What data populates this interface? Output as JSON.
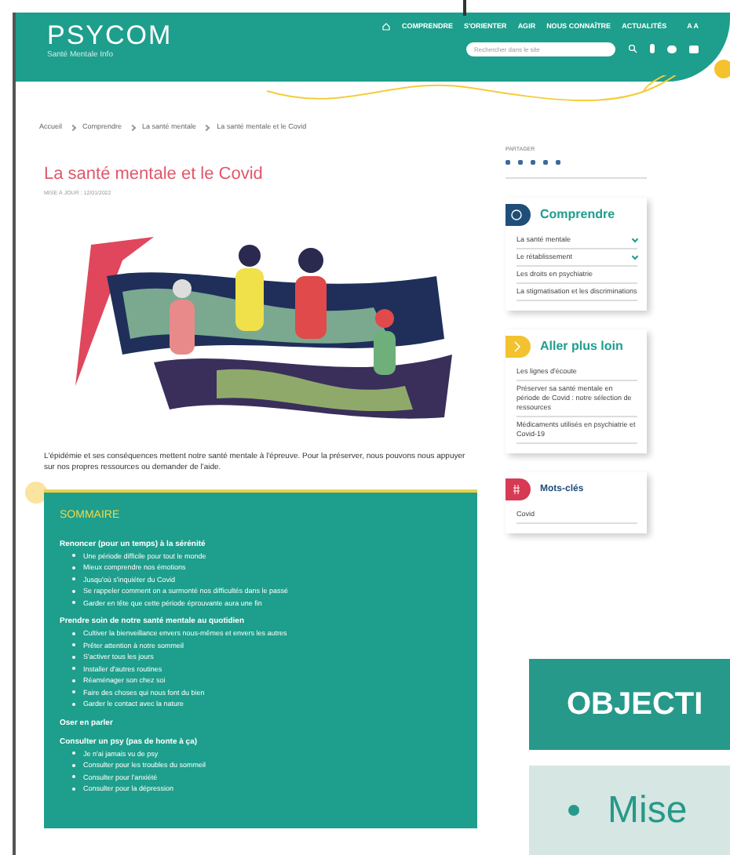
{
  "header": {
    "logo": "PSYCOM",
    "tagline": "Santé Mentale Info",
    "nav": [
      "COMPRENDRE",
      "S'ORIENTER",
      "AGIR",
      "NOUS CONNAÎTRE",
      "ACTUALITÉS"
    ],
    "font_size": "A A",
    "search": {
      "placeholder": "Rechercher dans le site"
    }
  },
  "breadcrumb": [
    "Accueil",
    "Comprendre",
    "La santé mentale",
    "La santé mentale et le Covid"
  ],
  "article": {
    "title": "La santé mentale et le Covid",
    "date": "MISE À JOUR : 12/01/2022",
    "intro": "L'épidémie et ses conséquences mettent notre santé mentale à l'épreuve. Pour la préserver, nous pouvons nous appuyer sur nos propres ressources ou demander de l'aide."
  },
  "summary": {
    "title": "SOMMAIRE",
    "sections": [
      {
        "heading": "Renoncer (pour un temps) à la sérénité",
        "items": [
          "Une période difficile pour tout le monde",
          "Mieux comprendre nos émotions",
          "Jusqu'où s'inquiéter du Covid",
          "Se rappeler comment on a surmonté nos difficultés dans le passé",
          "Garder en tête que cette période éprouvante aura une fin"
        ]
      },
      {
        "heading": "Prendre soin de notre santé mentale au quotidien",
        "items": [
          "Cultiver la bienveillance envers nous-mêmes et envers les autres",
          "Prêter attention à notre sommeil",
          "S'activer tous les jours",
          "Installer d'autres routines",
          "Réaménager son chez soi",
          "Faire des choses qui nous font du bien",
          "Garder le contact avec la nature"
        ]
      },
      {
        "heading": "Oser en parler"
      },
      {
        "heading": "Consulter un psy (pas de honte à ça)",
        "items": [
          "Je n'ai jamais vu de psy",
          "Consulter pour les troubles du sommeil",
          "Consulter pour l'anxiété",
          "Consulter pour la dépression"
        ]
      }
    ]
  },
  "sidebar": {
    "share_label": "PARTAGER",
    "cards": [
      {
        "kind": "comprendre",
        "color": "#1f4e79",
        "title": "Comprendre",
        "items": [
          {
            "label": "La santé mentale",
            "has_children": true
          },
          {
            "label": "Le rétablissement",
            "has_children": true
          },
          {
            "label": "Les droits en psychiatrie",
            "has_children": false
          },
          {
            "label": "La stigmatisation et les discriminations",
            "has_children": false
          }
        ]
      },
      {
        "kind": "aller",
        "color": "#f2c230",
        "title": "Aller plus loin",
        "items": [
          {
            "label": "Les lignes d'écoute",
            "has_children": false
          },
          {
            "label": "Préserver sa santé mentale en période de Covid : notre sélection de ressources",
            "has_children": false
          },
          {
            "label": "Médicaments utilisés en psychiatrie et Covid-19",
            "has_children": false
          }
        ]
      },
      {
        "kind": "tags",
        "color": "#d63a54",
        "title": "Mots-clés",
        "items": [
          {
            "label": "Covid",
            "has_children": false
          }
        ]
      }
    ]
  },
  "overlay": {
    "heading": "OBJECTI",
    "bullet": "Mise"
  }
}
